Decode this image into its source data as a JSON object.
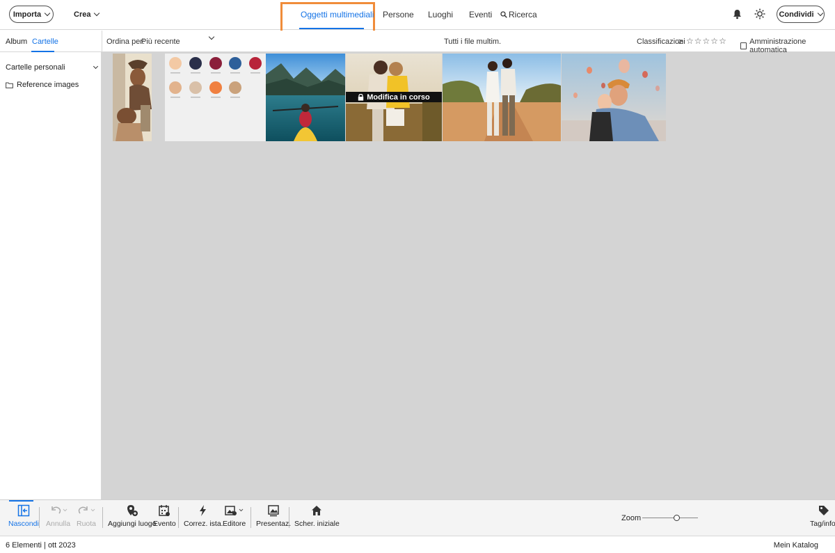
{
  "header": {
    "import_label": "Importa",
    "create_label": "Crea",
    "share_label": "Condividi",
    "tabs": [
      {
        "label": "Oggetti multimediali",
        "active": true
      },
      {
        "label": "Persone"
      },
      {
        "label": "Luoghi"
      },
      {
        "label": "Eventi"
      },
      {
        "label": "Ricerca"
      }
    ],
    "icons": [
      "bell-icon",
      "sun-icon",
      "search-icon"
    ]
  },
  "sidebar": {
    "tabs": [
      "Album",
      "Cartelle"
    ],
    "section_title": "Cartelle personali",
    "folders": [
      "Reference images"
    ]
  },
  "filterbar": {
    "sort_label": "Ordina per:",
    "sort_value": "Più recente",
    "center_text": "Tutti i file multim.",
    "ratings_label": "Classificazioni",
    "ratings_operator": "≥",
    "auto_curation_label": "Amministrazione automatica"
  },
  "grid": {
    "editing_overlay": "Modifica in corso"
  },
  "toolbar": {
    "hide": "Nascondi",
    "undo": "Annulla",
    "rotate": "Ruota",
    "add_place": "Aggiungi luogo",
    "event": "Evento",
    "instant_fix": "Correz. ista.",
    "editor": "Editore",
    "slideshow": "Presentaz.",
    "home_screen": "Scher. iniziale",
    "zoom": "Zoom",
    "zoom_level": 0.62,
    "tags_info": "Tag/info."
  },
  "status": {
    "left": "6 Elementi | ott 2023",
    "right": "Mein Katalog"
  },
  "colors": {
    "accent": "#1473e6",
    "highlight": "#f08c3a",
    "grid_bg": "#d4d4d4"
  }
}
